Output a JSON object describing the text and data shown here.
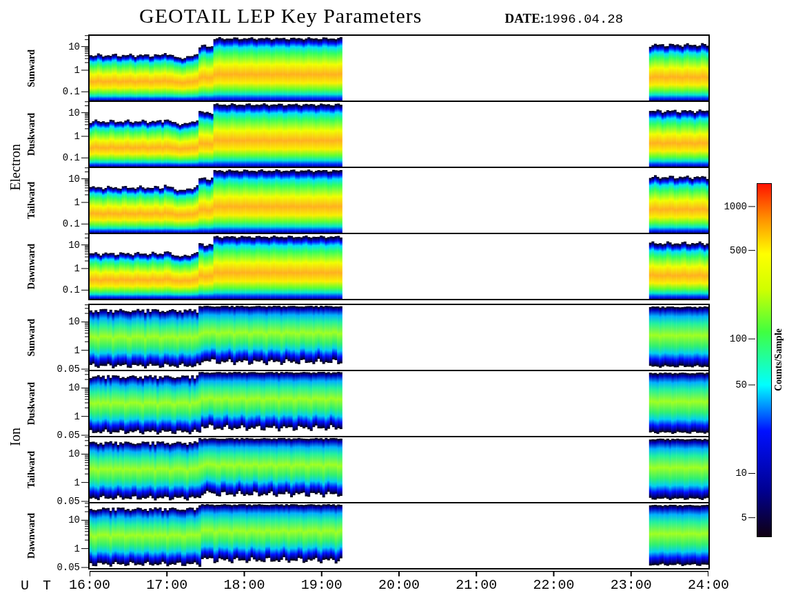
{
  "title": "GEOTAIL LEP Key Parameters",
  "date_label": "DATE:",
  "date": "1996.04.28",
  "groups": [
    {
      "species": "Electron",
      "kind": "electron",
      "panels": [
        {
          "direction": "Sunward",
          "yticks": [
            "10",
            "1",
            "0.1"
          ]
        },
        {
          "direction": "Duskward",
          "yticks": [
            "10",
            "1",
            "0.1"
          ]
        },
        {
          "direction": "Tailward",
          "yticks": [
            "10",
            "1",
            "0.1"
          ]
        },
        {
          "direction": "Dawnward",
          "yticks": [
            "10",
            "1",
            "0.1"
          ]
        }
      ]
    },
    {
      "species": "Ion",
      "kind": "ion",
      "panels": [
        {
          "direction": "Sunward",
          "yticks": [
            "10",
            "1",
            "0.05"
          ]
        },
        {
          "direction": "Duskward",
          "yticks": [
            "10",
            "1",
            "0.05"
          ]
        },
        {
          "direction": "Tailward",
          "yticks": [
            "10",
            "1",
            "0.05"
          ]
        },
        {
          "direction": "Dawnward",
          "yticks": [
            "10",
            "1",
            "0.05"
          ]
        }
      ]
    }
  ],
  "xaxis": {
    "label": "U T",
    "ticks": [
      "16:00",
      "17:00",
      "18:00",
      "19:00",
      "20:00",
      "21:00",
      "22:00",
      "23:00",
      "24:00"
    ]
  },
  "colorbar": {
    "label": "Counts/Sample",
    "ticks": [
      "1000",
      "500",
      "100",
      "50",
      "10",
      "5"
    ]
  }
}
